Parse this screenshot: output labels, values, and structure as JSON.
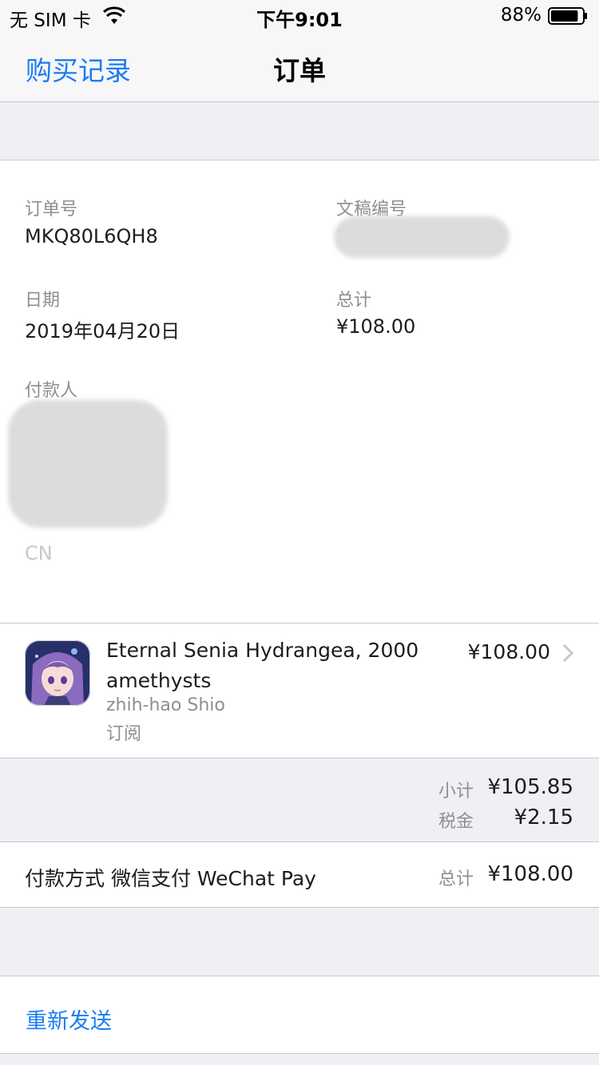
{
  "status_bar": {
    "carrier": "无 SIM 卡",
    "time": "下午9:01",
    "battery_percent": "88%",
    "battery_level": 0.88
  },
  "nav": {
    "back_label": "购买记录",
    "title": "订单"
  },
  "order": {
    "order_no_label": "订单号",
    "order_no": "MKQ80L6QH8",
    "doc_no_label": "文稿编号",
    "doc_no_visible": "1",
    "date_label": "日期",
    "date": "2019年04月20日",
    "total_label": "总计",
    "total": "¥108.00",
    "payer_label": "付款人",
    "payer_country": "CN"
  },
  "item": {
    "icon": "app-icon-anime-girl",
    "title": "Eternal Senia Hydrangea, 2000 amethysts",
    "developer": "zhih-hao Shio",
    "type": "订阅",
    "price": "¥108.00"
  },
  "summary": {
    "subtotal_label": "小计",
    "subtotal": "¥105.85",
    "tax_label": "税金",
    "tax": "¥2.15"
  },
  "payment": {
    "method": "付款方式 微信支付 WeChat Pay",
    "total_label": "总计",
    "total": "¥108.00"
  },
  "actions": {
    "resend": "重新发送"
  },
  "colors": {
    "accent": "#1a7cf4",
    "background": "#efeff4",
    "secondary_text": "#8e8e93"
  }
}
